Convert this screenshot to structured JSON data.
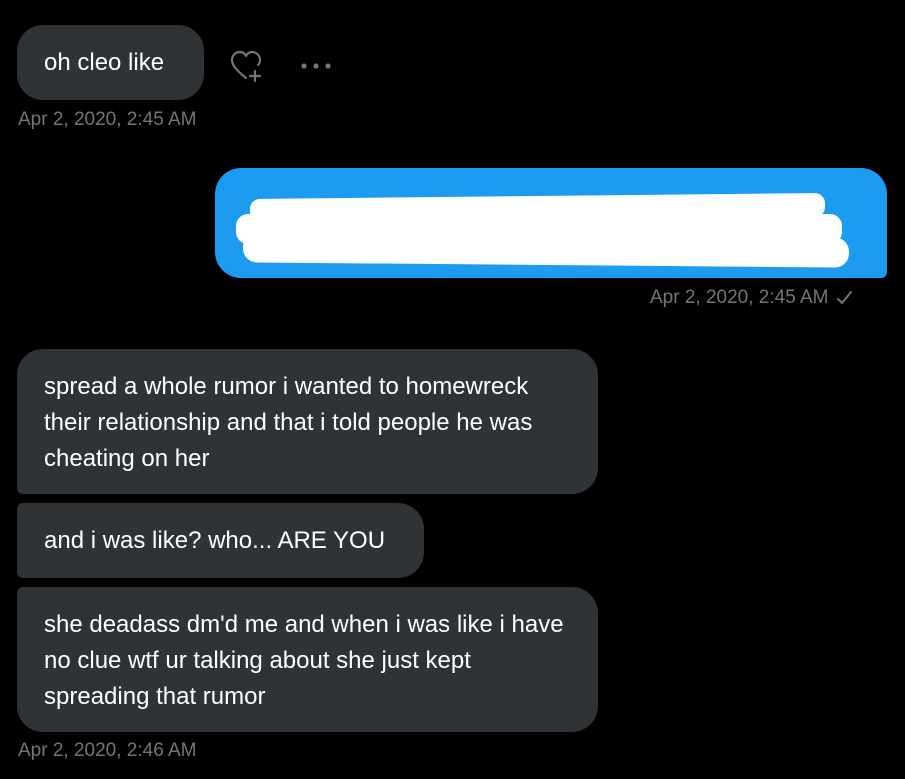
{
  "messages": [
    {
      "text": "oh cleo like"
    },
    {
      "text": "spread a whole rumor i wanted to homewreck their relationship and that i told people he was cheating on her"
    },
    {
      "text": "and i was like? who... ARE YOU"
    },
    {
      "text": "she deadass dm'd me and when i was like i have no clue wtf ur talking about she just kept spreading that rumor"
    }
  ],
  "timestamps": {
    "first": "Apr 2, 2020, 2:45 AM",
    "sent": "Apr 2, 2020, 2:45 AM",
    "last": "Apr 2, 2020, 2:46 AM"
  },
  "icons": {
    "react": "heart-plus-icon",
    "more": "more-horizontal-icon",
    "read_receipt": "checkmark-icon"
  },
  "colors": {
    "background": "#000000",
    "received_bubble": "#2f3336",
    "sent_bubble": "#1d9bf0",
    "timestamp": "#71767b"
  }
}
